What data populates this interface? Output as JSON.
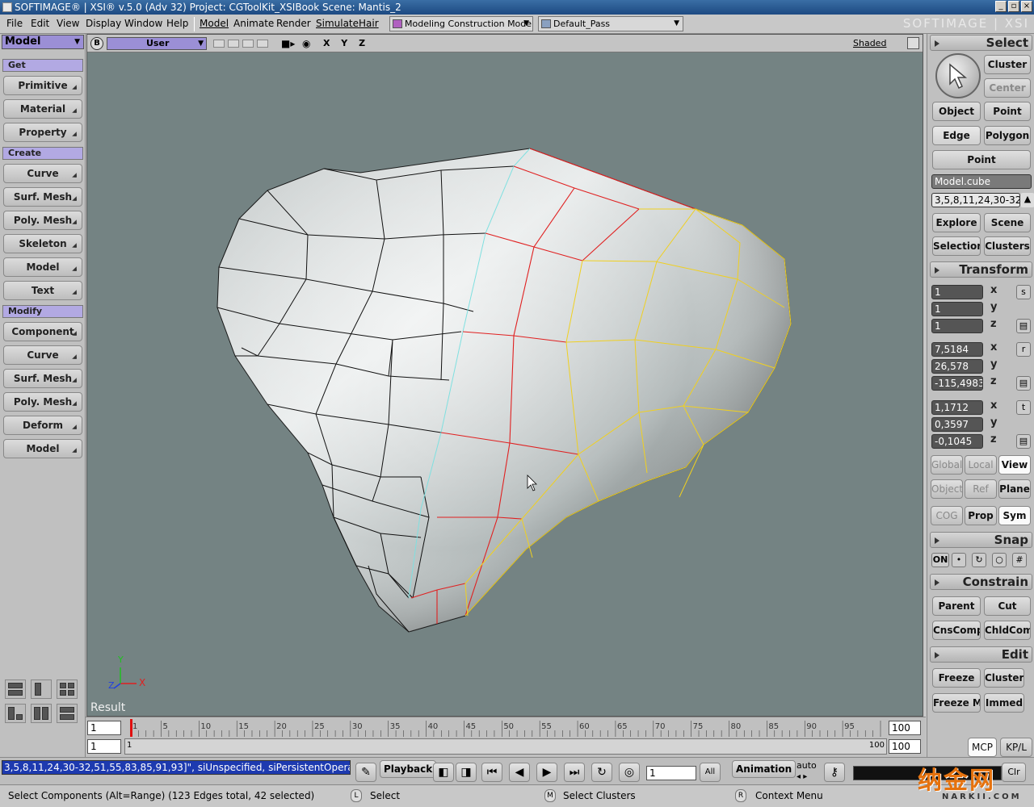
{
  "titlebar": {
    "title": "SOFTIMAGE® | XSI® v.5.0 (Adv 32) Project: CGToolKit_XSIBook    Scene: Mantis_2"
  },
  "menubar": {
    "items": [
      "File",
      "Edit",
      "View",
      "Display",
      "Window",
      "Help"
    ],
    "modules": [
      "Model",
      "Animate",
      "Render",
      "Simulate",
      "Hair"
    ],
    "construction_mode": "Modeling Construction Mode",
    "render_pass": "Default_Pass",
    "logo": "SOFTIMAGE | XSI"
  },
  "left_toolbar": {
    "mode": "Model",
    "sections": [
      {
        "header": "Get",
        "buttons": [
          "Primitive",
          "Material",
          "Property"
        ]
      },
      {
        "header": "Create",
        "buttons": [
          "Curve",
          "Surf. Mesh",
          "Poly. Mesh",
          "Skeleton",
          "Model",
          "Text"
        ]
      },
      {
        "header": "Modify",
        "buttons": [
          "Component",
          "Curve",
          "Surf. Mesh",
          "Poly. Mesh",
          "Deform",
          "Model"
        ]
      }
    ]
  },
  "viewport": {
    "camera": "User",
    "axes_label": "X Y Z",
    "display_mode": "Shaded",
    "result_label": "Result",
    "axis_x": "X",
    "axis_y": "Y",
    "axis_z": "Z",
    "b_button": "B"
  },
  "right_panel": {
    "select": {
      "header": "Select",
      "cluster": "Cluster",
      "center": "Center",
      "object": "Object",
      "point": "Point",
      "edge": "Edge",
      "polygon": "Polygon",
      "point_menu": "Point",
      "object_name": "Model.cube",
      "components": "3,5,8,11,24,30-32",
      "explore": "Explore",
      "scene": "Scene",
      "selection": "Selection",
      "clusters": "Clusters"
    },
    "transform": {
      "header": "Transform",
      "scale": [
        "1",
        "1",
        "1"
      ],
      "rotate": [
        "7,5184",
        "26,578",
        "-115,4983"
      ],
      "translate": [
        "1,1712",
        "0,3597",
        "-0,1045"
      ],
      "axes": [
        "x",
        "y",
        "z"
      ],
      "srt": [
        "s",
        "r",
        "t"
      ],
      "global": "Global",
      "local": "Local",
      "view": "View",
      "object": "Object",
      "ref": "Ref",
      "plane": "Plane",
      "cog": "COG",
      "prop": "Prop",
      "sym": "Sym"
    },
    "snap": {
      "header": "Snap",
      "on": "ON"
    },
    "constrain": {
      "header": "Constrain",
      "parent": "Parent",
      "cut": "Cut",
      "cnscomp": "CnsComp",
      "chldcomp": "ChldComp"
    },
    "edit": {
      "header": "Edit",
      "freeze": "Freeze",
      "cluster": "Cluster",
      "freeze_m": "Freeze M",
      "immed": "Immed"
    },
    "mcp": "MCP",
    "kpl": "KP/L"
  },
  "timeline": {
    "start": "1",
    "end": "100",
    "current": "1",
    "range_start": "1",
    "range_end": "100",
    "range_end_field": "100",
    "ticks": [
      "1",
      "5",
      "10",
      "15",
      "20",
      "25",
      "30",
      "35",
      "40",
      "45",
      "50",
      "55",
      "60",
      "65",
      "70",
      "75",
      "80",
      "85",
      "90",
      "95"
    ]
  },
  "cmdbar": {
    "command": "3,5,8,11,24,30-32,51,55,83,85,91,93]\", siUnspecified, siPersistentOperation",
    "playback": "Playback",
    "frame": "1",
    "all": "All",
    "animation": "Animation",
    "auto": "auto",
    "clr": "Clr"
  },
  "statusbar": {
    "message": "Select Components (Alt=Range) (123 Edges total, 42 selected)",
    "l_key": "L",
    "l_action": "Select",
    "m_key": "M",
    "m_action": "Select Clusters",
    "r_key": "R",
    "r_action": "Context Menu"
  },
  "watermark": {
    "text": "纳金网",
    "url": "NARKII.COM"
  }
}
